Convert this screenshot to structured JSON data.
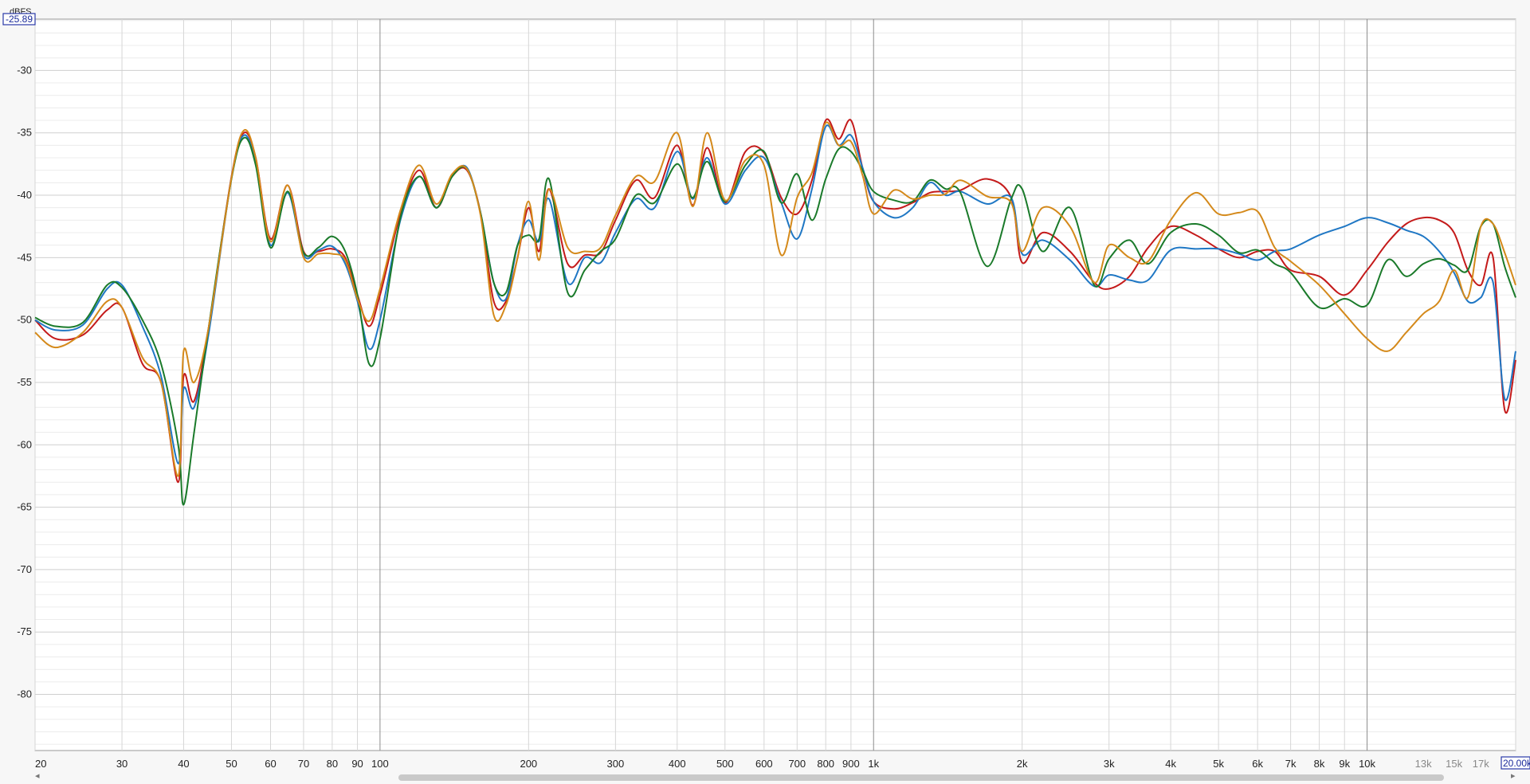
{
  "chart_data": {
    "type": "line",
    "x_scale": "log",
    "xlim": [
      20,
      20000
    ],
    "ylim": [
      -84.5,
      -25.89
    ],
    "y_unit": "dBFS",
    "y_readout": "-25.89",
    "x_readout": "20.00k",
    "grid": true,
    "x_ticks": [
      {
        "v": 20,
        "t": "20"
      },
      {
        "v": 30,
        "t": "30"
      },
      {
        "v": 40,
        "t": "40"
      },
      {
        "v": 50,
        "t": "50"
      },
      {
        "v": 60,
        "t": "60"
      },
      {
        "v": 70,
        "t": "70"
      },
      {
        "v": 80,
        "t": "80"
      },
      {
        "v": 90,
        "t": "90"
      },
      {
        "v": 100,
        "t": "100"
      },
      {
        "v": 200,
        "t": "200"
      },
      {
        "v": 300,
        "t": "300"
      },
      {
        "v": 400,
        "t": "400"
      },
      {
        "v": 500,
        "t": "500"
      },
      {
        "v": 600,
        "t": "600"
      },
      {
        "v": 700,
        "t": "700"
      },
      {
        "v": 800,
        "t": "800"
      },
      {
        "v": 900,
        "t": "900"
      },
      {
        "v": 1000,
        "t": "1k"
      },
      {
        "v": 2000,
        "t": "2k"
      },
      {
        "v": 3000,
        "t": "3k"
      },
      {
        "v": 4000,
        "t": "4k"
      },
      {
        "v": 5000,
        "t": "5k"
      },
      {
        "v": 6000,
        "t": "6k"
      },
      {
        "v": 7000,
        "t": "7k"
      },
      {
        "v": 8000,
        "t": "8k"
      },
      {
        "v": 9000,
        "t": "9k"
      },
      {
        "v": 10000,
        "t": "10k"
      },
      {
        "v": 13000,
        "t": "13k",
        "dim": true
      },
      {
        "v": 15000,
        "t": "15k",
        "dim": true
      },
      {
        "v": 17000,
        "t": "17k",
        "dim": true
      }
    ],
    "y_ticks": [
      -30,
      -35,
      -40,
      -45,
      -50,
      -55,
      -60,
      -65,
      -70,
      -75,
      -80
    ],
    "series": [
      {
        "color": "#c41a1a",
        "x": [
          20,
          22,
          25,
          28,
          30,
          33,
          36,
          39,
          40,
          42,
          45,
          50,
          53,
          56,
          60,
          65,
          70,
          75,
          80,
          85,
          90,
          95,
          100,
          110,
          120,
          130,
          140,
          150,
          160,
          170,
          180,
          190,
          200,
          210,
          220,
          240,
          260,
          280,
          300,
          330,
          360,
          400,
          430,
          460,
          500,
          550,
          600,
          650,
          700,
          750,
          800,
          850,
          900,
          950,
          1000,
          1100,
          1200,
          1300,
          1400,
          1500,
          1700,
          1900,
          2000,
          2200,
          2500,
          2800,
          3000,
          3300,
          3600,
          4000,
          4500,
          5000,
          5500,
          6000,
          6500,
          7000,
          8000,
          9000,
          10000,
          11000,
          12000,
          13000,
          14000,
          15000,
          16000,
          17000,
          18000,
          19000,
          20000
        ],
        "y": [
          -50,
          -51.5,
          -51.2,
          -49.2,
          -49,
          -53.5,
          -55,
          -63,
          -54.5,
          -56.5,
          -50.5,
          -38.5,
          -35,
          -37,
          -43.5,
          -39.2,
          -44.5,
          -44.5,
          -44.3,
          -45,
          -48,
          -50.5,
          -48,
          -41.5,
          -38,
          -41,
          -38.5,
          -38,
          -41.5,
          -48.5,
          -48.5,
          -45,
          -41,
          -44.5,
          -39.5,
          -45.5,
          -44.8,
          -44.6,
          -42,
          -38.8,
          -40.2,
          -36,
          -40.8,
          -36.2,
          -40.6,
          -36.5,
          -36.6,
          -40.2,
          -41.5,
          -38.8,
          -34,
          -35.5,
          -34,
          -37.8,
          -40.5,
          -41.1,
          -40.6,
          -39.8,
          -39.7,
          -39.6,
          -38.7,
          -40.2,
          -45.4,
          -43,
          -44.5,
          -47,
          -47.5,
          -46.5,
          -44.2,
          -42.5,
          -43.2,
          -44.3,
          -45,
          -44.5,
          -44.5,
          -46,
          -46.5,
          -48,
          -46,
          -43.8,
          -42.3,
          -41.8,
          -42,
          -43,
          -46,
          -47.2,
          -45,
          -57.2,
          -53.2
        ]
      },
      {
        "color": "#1f77c4",
        "x": [
          20,
          22,
          25,
          28,
          30,
          33,
          36,
          39,
          40,
          42,
          45,
          50,
          53,
          56,
          60,
          65,
          70,
          75,
          80,
          85,
          90,
          95,
          100,
          110,
          120,
          130,
          140,
          150,
          160,
          170,
          180,
          190,
          200,
          210,
          220,
          240,
          260,
          280,
          300,
          330,
          360,
          400,
          430,
          460,
          500,
          550,
          600,
          650,
          700,
          750,
          800,
          850,
          900,
          950,
          1000,
          1100,
          1200,
          1300,
          1400,
          1500,
          1700,
          1900,
          2000,
          2200,
          2500,
          2800,
          3000,
          3300,
          3600,
          4000,
          4500,
          5000,
          5500,
          6000,
          6500,
          7000,
          8000,
          9000,
          10000,
          11000,
          12000,
          13000,
          14000,
          15000,
          16000,
          17000,
          18000,
          19000,
          20000
        ],
        "y": [
          -50,
          -50.8,
          -50.4,
          -47.5,
          -47.2,
          -50.5,
          -54.5,
          -61.5,
          -55.5,
          -57,
          -51,
          -38.6,
          -35.2,
          -37.5,
          -44,
          -39.8,
          -44.8,
          -44.4,
          -44.1,
          -45.5,
          -48.5,
          -52.3,
          -50,
          -42,
          -38.5,
          -41,
          -38.5,
          -37.8,
          -41.5,
          -47,
          -48.3,
          -44,
          -42,
          -43.7,
          -40.3,
          -47,
          -45,
          -45.4,
          -43,
          -40.3,
          -41,
          -36.5,
          -40.3,
          -37,
          -40.7,
          -38,
          -37,
          -40.6,
          -43.5,
          -39.5,
          -34.5,
          -36,
          -35.2,
          -37.8,
          -40.5,
          -41.8,
          -41,
          -39,
          -40,
          -39.7,
          -40.7,
          -40.2,
          -44.7,
          -43.6,
          -45.2,
          -47.3,
          -46.4,
          -46.8,
          -46.8,
          -44.4,
          -44.3,
          -44.3,
          -44.7,
          -45.2,
          -44.5,
          -44.3,
          -43.2,
          -42.5,
          -41.8,
          -42.2,
          -42.8,
          -43.3,
          -44.5,
          -46.2,
          -48.5,
          -48.2,
          -47,
          -56.3,
          -52.5
        ]
      },
      {
        "color": "#1a7a2a",
        "x": [
          20,
          22,
          25,
          28,
          30,
          33,
          36,
          39,
          40,
          42,
          45,
          50,
          53,
          56,
          60,
          65,
          70,
          75,
          80,
          85,
          90,
          95,
          100,
          110,
          120,
          130,
          140,
          150,
          160,
          170,
          180,
          190,
          200,
          210,
          220,
          240,
          260,
          280,
          300,
          330,
          360,
          400,
          430,
          460,
          500,
          550,
          600,
          650,
          700,
          750,
          800,
          850,
          900,
          950,
          1000,
          1100,
          1200,
          1300,
          1400,
          1500,
          1700,
          1900,
          2000,
          2200,
          2500,
          2800,
          3000,
          3300,
          3600,
          4000,
          4500,
          5000,
          5500,
          6000,
          6500,
          7000,
          8000,
          9000,
          10000,
          11000,
          12000,
          13000,
          14000,
          15000,
          16000,
          17000,
          18000,
          19000,
          20000
        ],
        "y": [
          -49.8,
          -50.5,
          -50.2,
          -47.2,
          -47.4,
          -50,
          -53.5,
          -60,
          -64.8,
          -59,
          -50.5,
          -38.7,
          -35.4,
          -37.6,
          -44.2,
          -39.7,
          -44.6,
          -44.2,
          -43.3,
          -44.5,
          -48,
          -53.5,
          -51.5,
          -41.8,
          -38.5,
          -41,
          -38.5,
          -37.9,
          -41.5,
          -47,
          -47.8,
          -44,
          -43.2,
          -43.5,
          -38.7,
          -47.8,
          -46,
          -44.5,
          -43.5,
          -40,
          -40.6,
          -37.5,
          -40.2,
          -37.3,
          -40.5,
          -37.6,
          -36.5,
          -40.6,
          -38.3,
          -42,
          -38.7,
          -36.3,
          -36.5,
          -38,
          -39.7,
          -40.4,
          -40.5,
          -38.8,
          -39.5,
          -39.8,
          -45.7,
          -40.3,
          -39.5,
          -44.5,
          -41,
          -47.2,
          -45.1,
          -43.6,
          -45.5,
          -43,
          -42.3,
          -43.2,
          -44.6,
          -44.4,
          -45.5,
          -46.2,
          -49,
          -48.3,
          -48.8,
          -45.2,
          -46.5,
          -45.5,
          -45.1,
          -45.6,
          -46,
          -42.5,
          -42.3,
          -45.7,
          -48.2
        ]
      },
      {
        "color": "#d4891a",
        "x": [
          20,
          22,
          25,
          28,
          30,
          33,
          36,
          39,
          40,
          42,
          45,
          50,
          53,
          56,
          60,
          65,
          70,
          75,
          80,
          85,
          90,
          95,
          100,
          110,
          120,
          130,
          140,
          150,
          160,
          170,
          180,
          190,
          200,
          210,
          220,
          240,
          260,
          280,
          300,
          330,
          360,
          400,
          430,
          460,
          500,
          550,
          600,
          650,
          700,
          750,
          800,
          850,
          900,
          950,
          1000,
          1100,
          1200,
          1300,
          1400,
          1500,
          1700,
          1900,
          2000,
          2200,
          2500,
          2800,
          3000,
          3300,
          3600,
          4000,
          4500,
          5000,
          5500,
          6000,
          6500,
          7000,
          8000,
          9000,
          10000,
          11000,
          12000,
          13000,
          14000,
          15000,
          16000,
          17000,
          18000,
          19000,
          20000
        ],
        "y": [
          -51,
          -52.2,
          -51,
          -48.5,
          -49,
          -53,
          -55,
          -62.5,
          -52.5,
          -55,
          -50.5,
          -38.6,
          -34.8,
          -37,
          -43.7,
          -39.2,
          -45,
          -44.7,
          -44.7,
          -45.2,
          -48.3,
          -50.1,
          -47.5,
          -41.2,
          -37.6,
          -40.7,
          -38.3,
          -37.9,
          -41.7,
          -49.6,
          -48.8,
          -45,
          -40.5,
          -45.2,
          -39.5,
          -44.2,
          -44.5,
          -44.2,
          -41.6,
          -38.5,
          -38.9,
          -35,
          -40.9,
          -35,
          -40.4,
          -37.2,
          -37.6,
          -44.8,
          -40.2,
          -38.2,
          -34.2,
          -36,
          -35.7,
          -38.4,
          -41.5,
          -39.6,
          -40.3,
          -40,
          -39.9,
          -38.8,
          -40.1,
          -40.6,
          -44.5,
          -41,
          -42.5,
          -47,
          -44,
          -45,
          -45.3,
          -42,
          -39.8,
          -41.5,
          -41.4,
          -41.3,
          -44.2,
          -45.3,
          -47.2,
          -49.5,
          -51.5,
          -52.5,
          -51,
          -49.5,
          -48.5,
          -46,
          -48.2,
          -42.5,
          -42.3,
          -44.6,
          -47.2
        ]
      }
    ]
  }
}
